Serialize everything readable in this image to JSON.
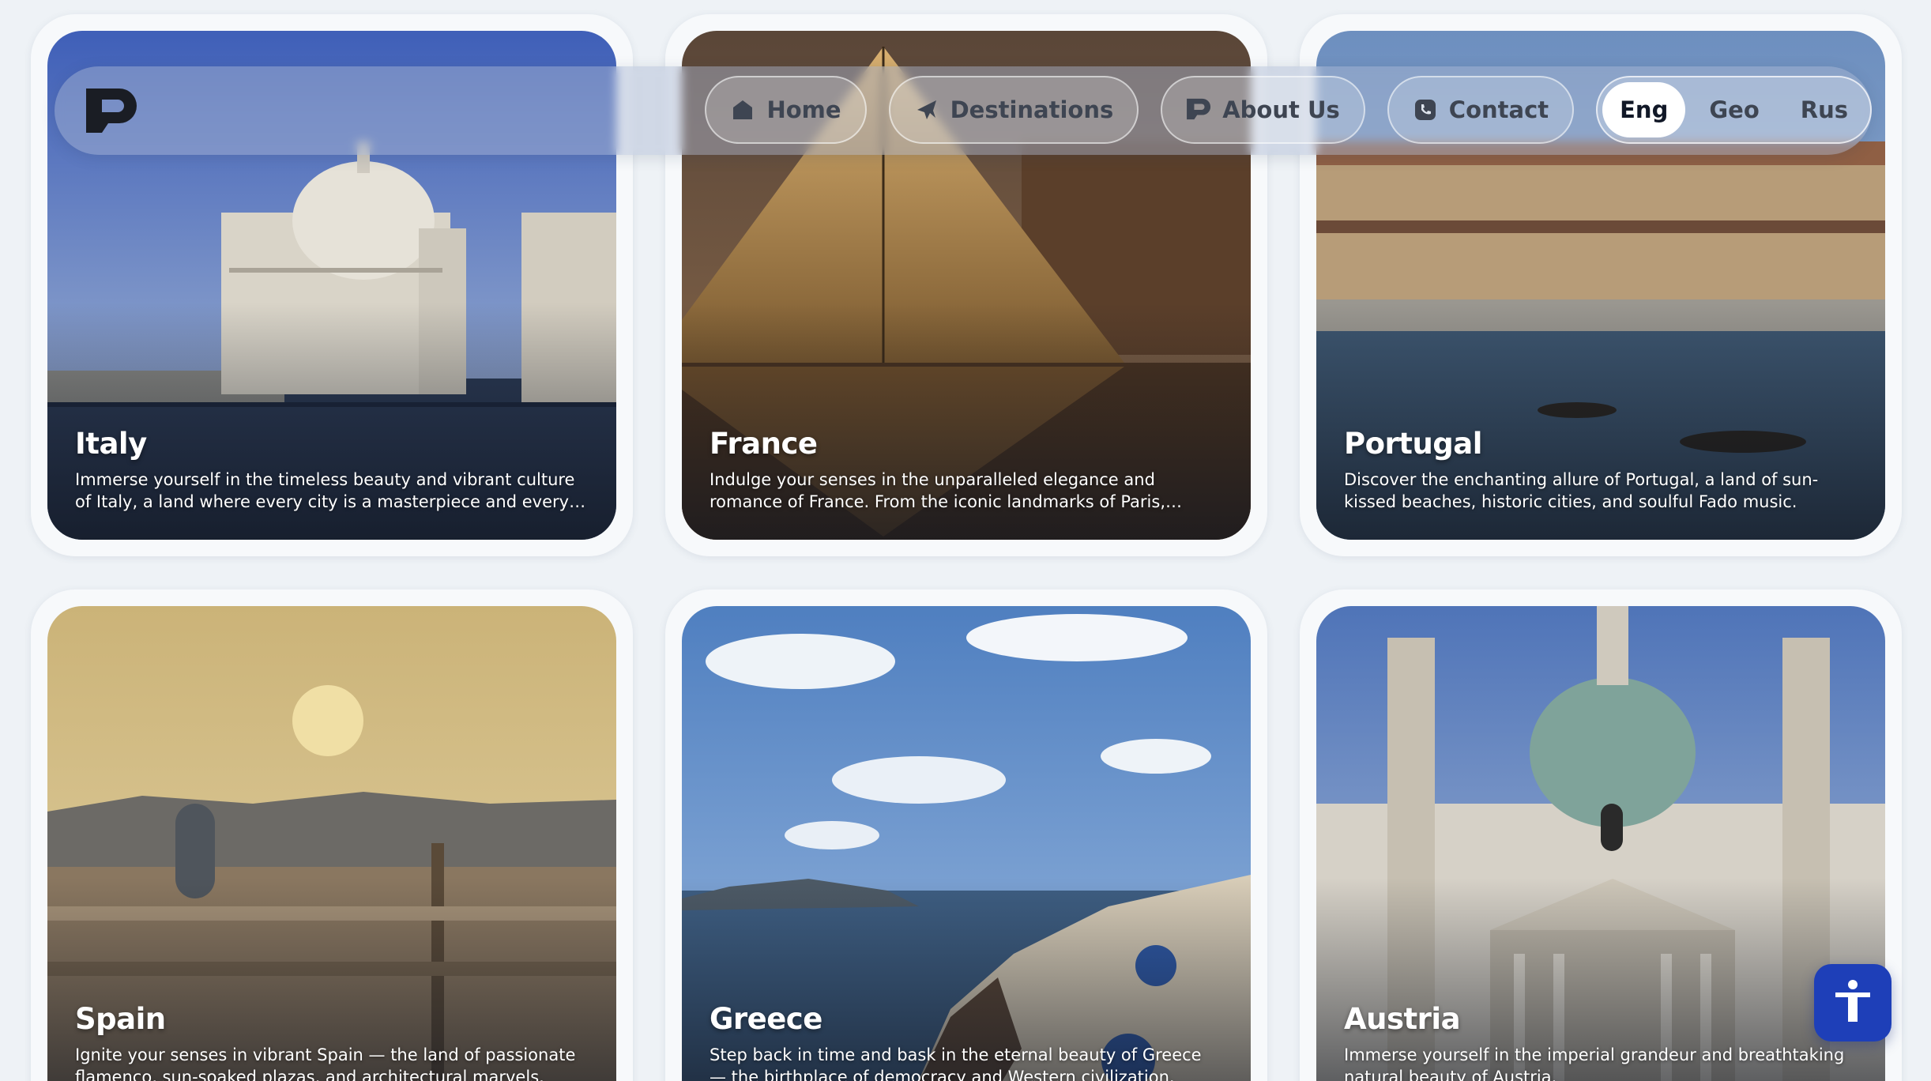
{
  "nav": {
    "items": [
      {
        "label": "Home",
        "icon": "home-icon"
      },
      {
        "label": "Destinations",
        "icon": "plane-icon"
      },
      {
        "label": "About Us",
        "icon": "logo-icon"
      },
      {
        "label": "Contact",
        "icon": "phone-icon"
      }
    ],
    "languages": [
      "Eng",
      "Geo",
      "Rus"
    ],
    "active_language": "Eng"
  },
  "cards": [
    {
      "title": "Italy",
      "description": "Immerse yourself in the timeless beauty and vibrant culture of Italy, a land where every city is a masterpiece and every meal i..."
    },
    {
      "title": "France",
      "description": "Indulge your senses in the unparalleled elegance and romance of France. From the iconic landmarks of Paris, including the Eiff..."
    },
    {
      "title": "Portugal",
      "description": "Discover the enchanting allure of Portugal, a land of sun-kissed beaches, historic cities, and soulful Fado music."
    },
    {
      "title": "Spain",
      "description": "Ignite your senses in vibrant Spain — the land of passionate flamenco, sun-soaked plazas, and architectural marvels."
    },
    {
      "title": "Greece",
      "description": "Step back in time and bask in the eternal beauty of Greece — the birthplace of democracy and Western civilization."
    },
    {
      "title": "Austria",
      "description": "Immerse yourself in the imperial grandeur and breathtaking natural beauty of Austria."
    }
  ],
  "colors": {
    "accessibility_button": "#1e3fb8",
    "page_background": "#eef2f6"
  }
}
